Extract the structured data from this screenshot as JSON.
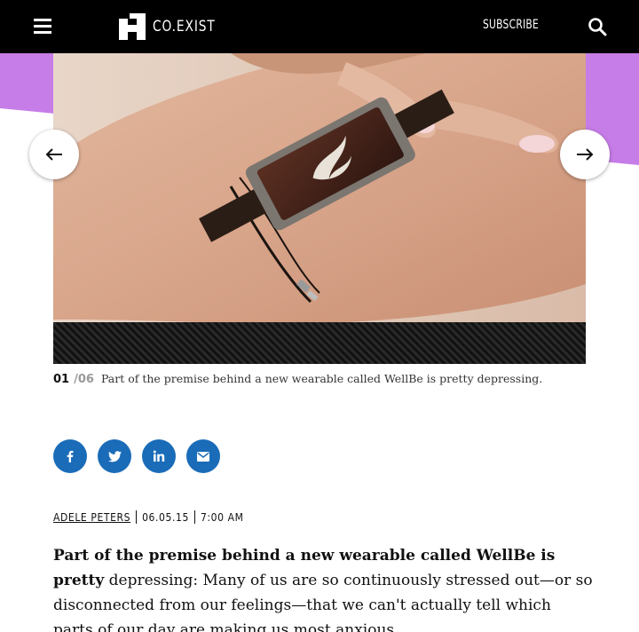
{
  "header": {
    "brand": "CO.EXIST",
    "subscribe_label": "SUBSCRIBE",
    "menu_icon": "hamburger-icon",
    "search_icon": "search-icon"
  },
  "colors": {
    "header_bg": "#000000",
    "accent_purple": "#c77de8",
    "share_blue": "#1a6cb8"
  },
  "slideshow": {
    "current": "01",
    "total": "/06",
    "caption": "Part of the premise behind a new wearable called WellBe is pretty depressing.",
    "image_description": "hand-wearing-wellbe-bracelet",
    "prev_icon": "arrow-left-icon",
    "next_icon": "arrow-right-icon"
  },
  "share": {
    "items": [
      "facebook-icon",
      "twitter-icon",
      "linkedin-icon",
      "email-icon"
    ]
  },
  "byline": {
    "author": "ADELE PETERS",
    "date": "06.05.15",
    "time": "7:00 AM"
  },
  "article": {
    "lead": "Part of the premise behind a new wearable called WellBe is pretty",
    "body": "depressing: Many of us are so continuously stressed out—or so disconnected from our feelings—that we can't actually tell which parts of our day are making us most anxious."
  }
}
